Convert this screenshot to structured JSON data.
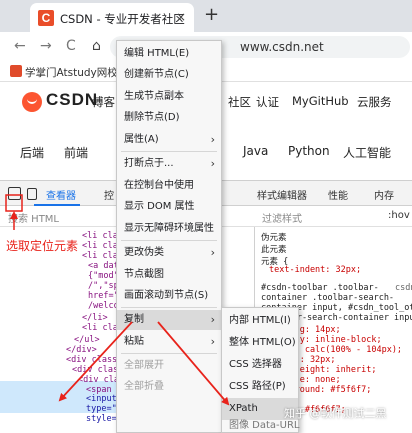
{
  "browser": {
    "tab_title": "CSDN - 专业开发者社区",
    "tab_favicon": "C",
    "tab_close": "×",
    "new_tab": "+",
    "back": "←",
    "forward": "→",
    "reload": "C",
    "home": "⌂",
    "url": "www.csdn.net",
    "bookmark": "学掌门Atstudy网校"
  },
  "site": {
    "logo": "CSDN",
    "nav": [
      "博客",
      "社区",
      "认证",
      "MyGitHub",
      "云服务"
    ],
    "categories": [
      "后端",
      "前端",
      "Java",
      "Python",
      "人工智能"
    ]
  },
  "devtools": {
    "tabs": [
      "查看器",
      "控",
      "样式编辑器",
      "性能",
      "内存"
    ],
    "filter_placeholder": "搜索 HTML",
    "style_filter": "过滤样式",
    "hov": ":hov",
    "elements": [
      "<li clas",
      "<li clas",
      "<li clas",
      "<a dat",
      "{\"mod\"",
      "/\",\"sp",
      "href=\"",
      "/welco",
      "</li>",
      "<li clas",
      "</ul>",
      "</div>",
      "<div class=\"",
      "<div class",
      "<div clas",
      "<span",
      "<input id=\"toolbar-search-input\"",
      "type=\"text\" value=\"\" placeholder",
      "style=\"text-indent: 32px;\">"
    ],
    "styles": [
      "伪元素",
      "此元素",
      "元素 {",
      "text-indent: 32px;",
      "#csdn-toolbar .toolbar-",
      "container .toolbar-search-",
      "container input, #csdn_tool_other",
      ".toolbar-search-container input",
      "padding: 14px;",
      "display: inline-block;",
      "width: calc(100% - 104px);",
      "height: 32px;",
      "line-height: inherit;",
      "outline: none;",
      "background: #f5f6f7;",
      "color: #f6f6f7;"
    ],
    "style_rule_link": "csdn-",
    "pick_annotation": "选取定位元素"
  },
  "context_menu": {
    "items": [
      {
        "label": "编辑 HTML(E)",
        "arrow": false,
        "disabled": false
      },
      {
        "label": "创建新节点(C)",
        "arrow": false,
        "disabled": false
      },
      {
        "label": "生成节点副本",
        "arrow": false,
        "disabled": false
      },
      {
        "label": "删除节点(D)",
        "arrow": false,
        "disabled": false
      },
      {
        "label": "属性(A)",
        "arrow": true,
        "disabled": false
      },
      {
        "label": "打断点于...",
        "arrow": true,
        "disabled": false
      },
      {
        "label": "在控制台中使用",
        "arrow": false,
        "disabled": false
      },
      {
        "label": "显示 DOM 属性",
        "arrow": false,
        "disabled": false
      },
      {
        "label": "显示无障碍环境属性",
        "arrow": false,
        "disabled": false
      },
      {
        "label": "更改伪类",
        "arrow": true,
        "disabled": false
      },
      {
        "label": "节点截图",
        "arrow": false,
        "disabled": false
      },
      {
        "label": "画面滚动到节点(S)",
        "arrow": false,
        "disabled": false
      },
      {
        "label": "复制",
        "arrow": true,
        "disabled": false
      },
      {
        "label": "粘贴",
        "arrow": true,
        "disabled": false
      },
      {
        "label": "全部展开",
        "arrow": false,
        "disabled": true
      },
      {
        "label": "全部折叠",
        "arrow": false,
        "disabled": true
      }
    ],
    "submenu": [
      "内部 HTML(I)",
      "整体 HTML(O)",
      "CSS 选择器",
      "CSS 路径(P)",
      "XPath",
      "图像 Data-URL"
    ]
  },
  "watermark": "知乎 @软件测试二黑",
  "colors": {
    "annotation_red": "#e8231b",
    "csdn_red": "#fc5531",
    "selection": "#cfe8fc"
  }
}
